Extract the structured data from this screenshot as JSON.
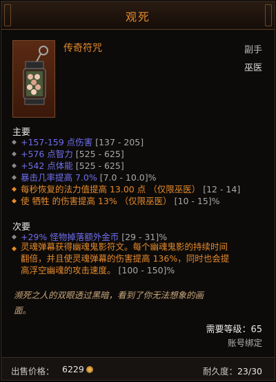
{
  "header": {
    "title": "观死"
  },
  "item": {
    "name": "传奇符咒",
    "slot": "副手",
    "class": "巫医",
    "icon": "lantern-charm-icon"
  },
  "primary": {
    "title": "主要",
    "stats": [
      {
        "text": "+157-159 点伤害 ",
        "range": "[137 - 205]",
        "legendary": false
      },
      {
        "text": "+576 点智力 ",
        "range": "[525 - 625]",
        "legendary": false
      },
      {
        "text": "+542 点体能 ",
        "range": "[525 - 625]",
        "legendary": false
      },
      {
        "text": "暴击几率提高 7.0% ",
        "range": "[7.0 - 10.0]%",
        "legendary": false
      },
      {
        "text": "每秒恢复的法力值提高 13.00 点 （仅限巫医） ",
        "range": "[12 - 14]",
        "legendary": true
      },
      {
        "text": "使 牺牲 的伤害提高 13% （仅限巫医） ",
        "range": "[10 - 15]%",
        "legendary": true
      }
    ]
  },
  "secondary": {
    "title": "次要",
    "stat1": {
      "text": "+29% 怪物掉落额外金币 ",
      "range": "[29 - 31]%"
    },
    "legendary_lines": [
      "灵魂弹幕获得幽魂鬼影符文。每个幽魂鬼影的持续时间",
      "翻倍，并且使灵魂弹幕的伤害提高 136%，同时也会提",
      "高浮空幽魂的攻击速度。"
    ],
    "legendary_range": "[100 - 150]%"
  },
  "flavor": [
    "濒死之人的双眼透过黑暗，看到了你无法想象的画",
    "面。"
  ],
  "requirement": "需要等级：65",
  "binding": "账号绑定",
  "footer": {
    "sell_label": "出售价格：",
    "sell_value": "6229",
    "durability_label": "耐久度：",
    "durability_value": "23/30"
  },
  "colors": {
    "legendary": "#e58a2d",
    "magic": "#6f6fee",
    "range": "#a9a9a9",
    "flavor": "#c7a57c"
  }
}
